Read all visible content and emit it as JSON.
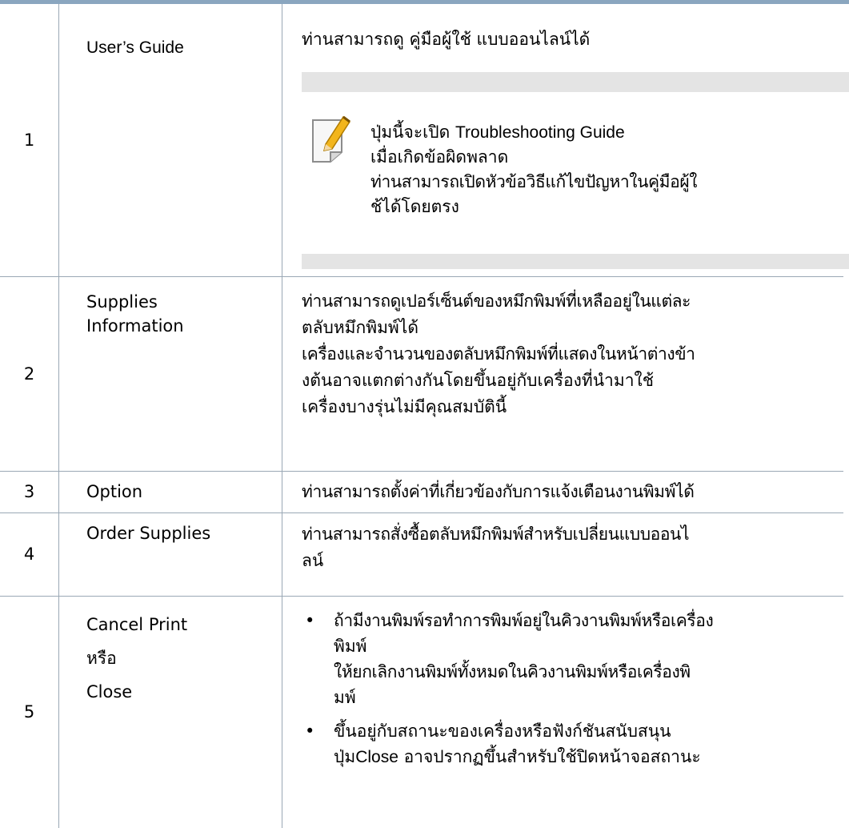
{
  "rows": [
    {
      "num": "1",
      "name": "User’s Guide",
      "desc": "ท่านสามารถดู คู่มือผู้ใช้ แบบออนไลน์ได้",
      "note": {
        "prefix": "ปุ่มนี้จะเปิด",
        "bold": "Troubleshooting Guide",
        "line2": "เมื่อเกิดข้อผิดพลาด",
        "line3": "ท่านสามารถเปิดหัวข้อวิธีแก้ไขปัญหาในคู่มือผู้ใ",
        "line4": "ช้ได้โดยตรง",
        "icon": "note-pencil-icon"
      }
    },
    {
      "num": "2",
      "name_line1": "Supplies",
      "name_line2": "Information",
      "desc_lines": [
        "ท่านสามารถดูเปอร์เซ็นต์ของหมึกพิมพ์ที่เหลืออยู่ในแต่ละ",
        "ตลับหมึกพิมพ์ได้",
        "เครื่องและจำนวนของตลับหมึกพิมพ์ที่แสดงในหน้าต่างข้า",
        "งต้นอาจแตกต่างกันโดยขึ้นอยู่กับเครื่องที่นำมาใช้",
        "เครื่องบางรุ่นไม่มีคุณสมบัตินี้"
      ]
    },
    {
      "num": "3",
      "name": "Option",
      "desc": "ท่านสามารถตั้งค่าที่เกี่ยวข้องกับการแจ้งเตือนงานพิมพ์ได้"
    },
    {
      "num": "4",
      "name": "Order Supplies",
      "desc_lines": [
        "ท่านสามารถสั่งซื้อตลับหมึกพิมพ์สำหรับเปลี่ยนแบบออนไ",
        "ลน์"
      ]
    },
    {
      "num": "5",
      "name_line1": "Cancel Print",
      "name_or": "หรือ",
      "name_line2": "Close",
      "bullet1_lines": [
        "ถ้ามีงานพิมพ์รอทำการพิมพ์อยู่ในคิวงานพิมพ์หรือเครื่อง",
        "พิมพ์",
        "ให้ยกเลิกงานพิมพ์ทั้งหมดในคิวงานพิมพ์หรือเครื่องพิ",
        "มพ์"
      ],
      "bullet2_line1": "ขึ้นอยู่กับสถานะของเครื่องหรือฟังก์ชันสนับสนุน",
      "bullet2_prefix": "ปุ่ม",
      "bullet2_bold": "Close",
      "bullet2_suffix": " อาจปรากฏขึ้นสำหรับใช้ปิดหน้าจอสถานะ"
    }
  ]
}
